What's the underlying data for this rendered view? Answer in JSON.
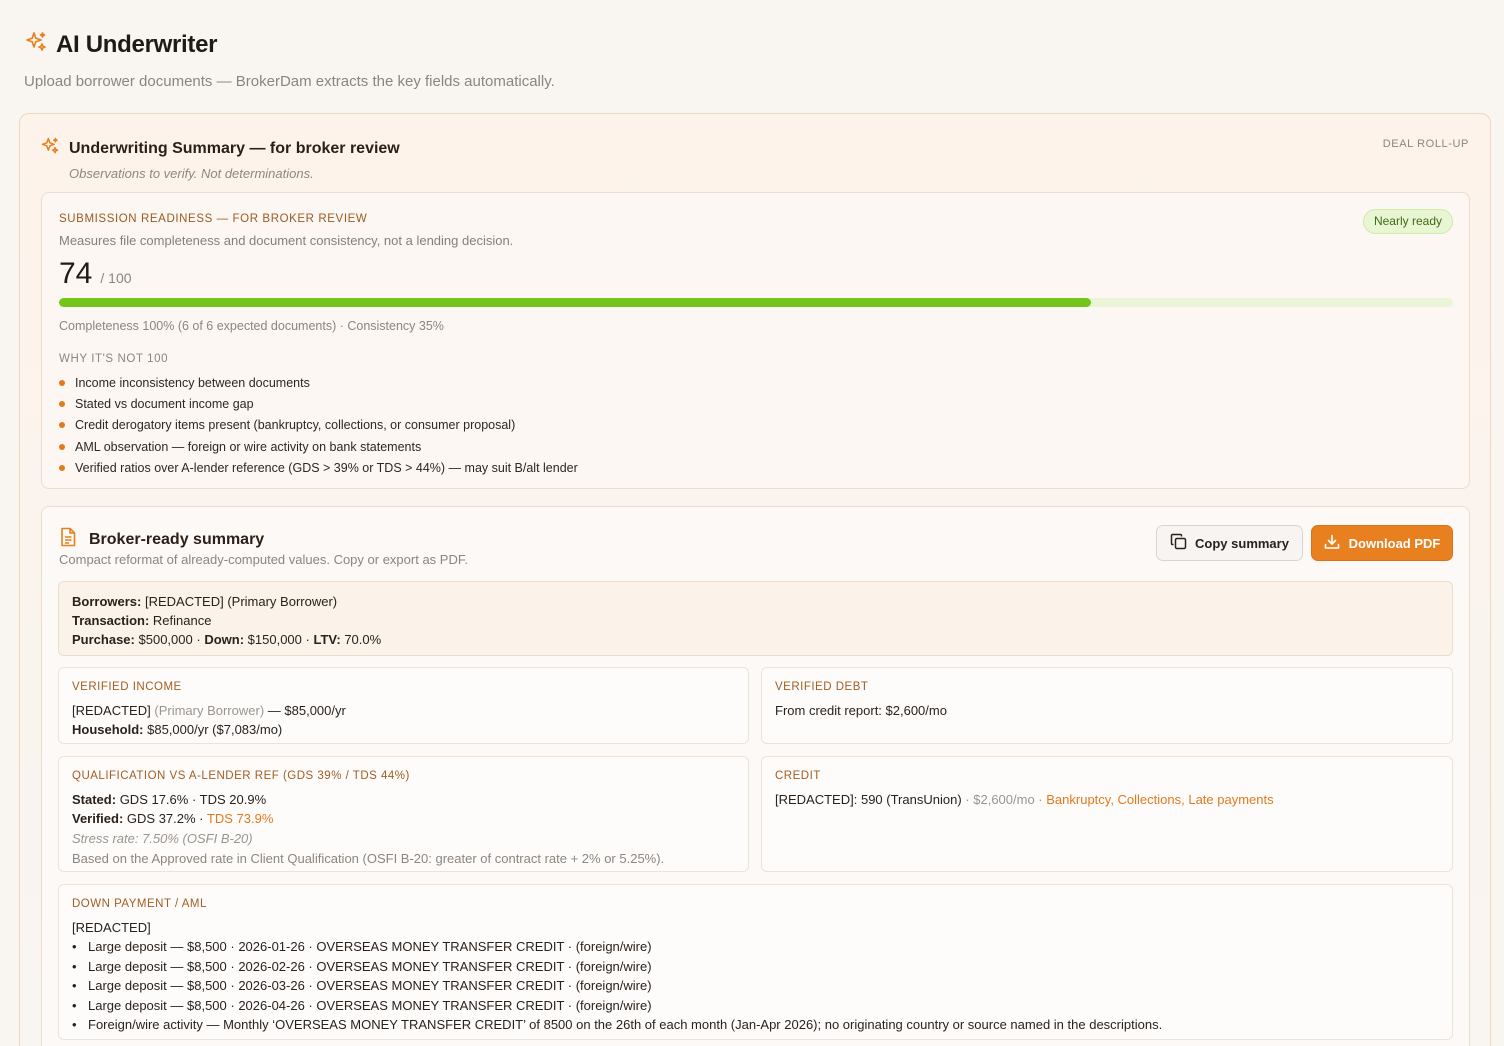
{
  "header": {
    "title": "AI Underwriter",
    "subtitle": "Upload borrower documents — BrokerDam extracts the key fields automatically."
  },
  "summary": {
    "title": "Underwriting Summary — for broker review",
    "note": "Observations to verify. Not determinations.",
    "rollup_label": "DEAL ROLL-UP"
  },
  "readiness": {
    "title": "SUBMISSION READINESS — FOR BROKER REVIEW",
    "description": "Measures file completeness and document consistency, not a lending decision.",
    "badge": "Nearly ready",
    "score": "74",
    "score_max": "/ 100",
    "progress_fraction": 0.74,
    "metrics": "Completeness 100% (6 of 6 expected documents) · Consistency 35%",
    "why_title": "WHY IT'S NOT 100",
    "reasons": [
      "Income inconsistency between documents",
      "Stated vs document income gap",
      "Credit derogatory items present (bankruptcy, collections, or consumer proposal)",
      "AML observation — foreign or wire activity on bank statements",
      "Verified ratios over A-lender reference (GDS > 39% or TDS > 44%) — may suit B/alt lender"
    ]
  },
  "broker": {
    "title": "Broker-ready summary",
    "description": "Compact reformat of already-computed values. Copy or export as PDF.",
    "copy_label": "Copy summary",
    "pdf_label": "Download PDF",
    "deal": {
      "borrowers_label": "Borrowers:",
      "borrowers_value": "[REDACTED] (Primary Borrower)",
      "transaction_label": "Transaction:",
      "transaction_value": "Refinance",
      "purchase_label": "Purchase:",
      "purchase_value": "$500,000",
      "down_label": "Down:",
      "down_value": "$150,000",
      "ltv_label": "LTV:",
      "ltv_value": "70.0%",
      "sep": "·"
    },
    "income": {
      "title": "VERIFIED INCOME",
      "name": "[REDACTED]",
      "role": "(Primary Borrower)",
      "amount": "— $85,000/yr",
      "household_label": "Household:",
      "household_value": "$85,000/yr ($7,083/mo)"
    },
    "debt": {
      "title": "VERIFIED DEBT",
      "line": "From credit report: $2,600/mo"
    },
    "qualification": {
      "title": "QUALIFICATION VS A-LENDER REF (GDS 39% / TDS 44%)",
      "stated_label": "Stated:",
      "stated_value": "GDS 17.6% · TDS 20.9%",
      "verified_label": "Verified:",
      "verified_gds": "GDS 37.2% ·",
      "verified_tds": "TDS 73.9%",
      "stress": "Stress rate: 7.50% (OSFI B-20)",
      "basis": "Based on the Approved rate in Client Qualification (OSFI B-20: greater of contract rate + 2% or 5.25%)."
    },
    "credit": {
      "title": "CREDIT",
      "name": "[REDACTED]:",
      "score": "590 (TransUnion)",
      "sep": "·",
      "debt": "$2,600/mo ·",
      "flags": "Bankruptcy, Collections, Late payments"
    },
    "down_payment": {
      "title": "DOWN PAYMENT / AML",
      "name": "[REDACTED]",
      "bullet": "•",
      "items": [
        "Large deposit — $8,500 · 2026-01-26 · OVERSEAS MONEY TRANSFER CREDIT · (foreign/wire)",
        "Large deposit — $8,500 · 2026-02-26 · OVERSEAS MONEY TRANSFER CREDIT · (foreign/wire)",
        "Large deposit — $8,500 · 2026-03-26 · OVERSEAS MONEY TRANSFER CREDIT · (foreign/wire)",
        "Large deposit — $8,500 · 2026-04-26 · OVERSEAS MONEY TRANSFER CREDIT · (foreign/wire)",
        "Foreign/wire activity — Monthly ‘OVERSEAS MONEY TRANSFER CREDIT’ of 8500 on the 26th of each month (Jan-Apr 2026); no originating country or source named in the descriptions."
      ]
    }
  },
  "colors": {
    "accent": "#e8801f",
    "progress": "#74c51a",
    "badge_bg": "#e8f6d4",
    "section_title": "#a25d22"
  },
  "icons": {
    "title_icon": "sparkle-icon",
    "summary_icon": "sparkle-icon",
    "doc_icon": "document-icon",
    "copy_icon": "copy-icon",
    "download_icon": "download-icon"
  }
}
